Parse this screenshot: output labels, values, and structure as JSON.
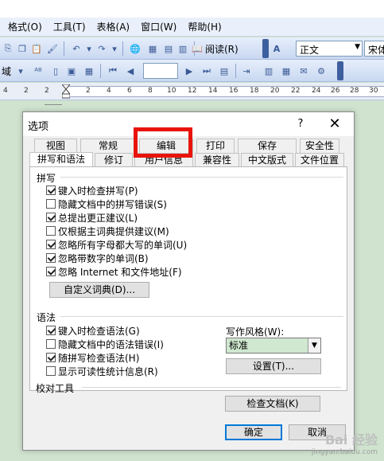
{
  "menubar": {
    "items": [
      "格式(O)",
      "工具(T)",
      "表格(A)",
      "窗口(W)",
      "帮助(H)"
    ]
  },
  "toolbar": {
    "reading_mode_label": "阅读(R)",
    "style_combo": "正文",
    "font_combo": "宋体",
    "field_label": "域"
  },
  "ruler": {
    "numbers": [
      "4",
      "2",
      "2",
      "2",
      "4",
      "6",
      "8",
      "10",
      "12",
      "14",
      "16",
      "18",
      "20",
      "22",
      "24",
      "26",
      "28",
      "30",
      "32"
    ]
  },
  "dialog": {
    "title": "选项",
    "help_glyph": "?",
    "close_glyph": "✕",
    "tabs_row1": [
      "视图",
      "常规",
      "编辑",
      "打印",
      "保存",
      "安全性"
    ],
    "tabs_row2": [
      "拼写和语法",
      "修订",
      "用户信息",
      "兼容性",
      "中文版式",
      "文件位置"
    ],
    "spelling": {
      "label": "拼写",
      "options": [
        {
          "label": "键入时检查拼写(P)",
          "checked": true
        },
        {
          "label": "隐藏文档中的拼写错误(S)",
          "checked": false
        },
        {
          "label": "总提出更正建议(L)",
          "checked": true
        },
        {
          "label": "仅根据主词典提供建议(M)",
          "checked": false
        },
        {
          "label": "忽略所有字母都大写的单词(U)",
          "checked": true
        },
        {
          "label": "忽略带数字的单词(B)",
          "checked": true
        },
        {
          "label": "忽略 Internet 和文件地址(F)",
          "checked": true
        }
      ],
      "custom_dict_button": "自定义词典(D)..."
    },
    "grammar": {
      "label": "语法",
      "options": [
        {
          "label": "键入时检查语法(G)",
          "checked": true
        },
        {
          "label": "隐藏文档中的语法错误(I)",
          "checked": false
        },
        {
          "label": "随拼写检查语法(H)",
          "checked": true
        },
        {
          "label": "显示可读性统计信息(R)",
          "checked": false
        }
      ],
      "writing_style_label": "写作风格(W):",
      "writing_style_value": "标准",
      "settings_button": "设置(T)..."
    },
    "proofing": {
      "label": "校对工具",
      "check_document_button": "检查文档(K)"
    },
    "ok_button": "确定",
    "cancel_button": "取消"
  },
  "watermark": {
    "top": "Bai 经验",
    "bottom": "jingyan.baidu.com"
  },
  "colors": {
    "highlight": "#e8140c",
    "page_bg": "#cfe3cf",
    "accent": "#0078d7"
  }
}
